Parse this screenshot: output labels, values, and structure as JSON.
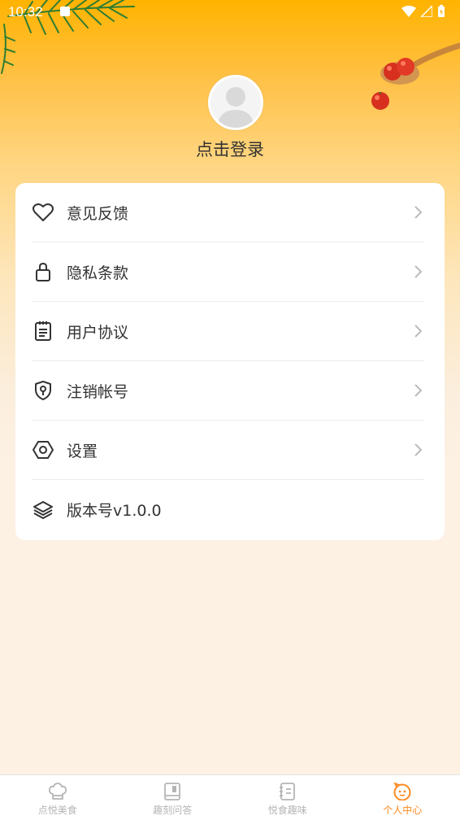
{
  "status_bar": {
    "time": "10:32"
  },
  "profile": {
    "login_text": "点击登录"
  },
  "menu": {
    "items": [
      {
        "label": "意见反馈",
        "icon": "heart-icon"
      },
      {
        "label": "隐私条款",
        "icon": "lock-icon"
      },
      {
        "label": "用户协议",
        "icon": "clipboard-icon"
      },
      {
        "label": "注销帐号",
        "icon": "shield-key-icon"
      },
      {
        "label": "设置",
        "icon": "hexagon-settings-icon"
      },
      {
        "label": "版本号v1.0.0",
        "icon": "layers-icon"
      }
    ]
  },
  "tabbar": {
    "tabs": [
      {
        "label": "点悦美食",
        "icon": "chef-hat-icon"
      },
      {
        "label": "趣刻问答",
        "icon": "book-icon"
      },
      {
        "label": "悦食趣味",
        "icon": "notebook-icon"
      },
      {
        "label": "个人中心",
        "icon": "smiley-icon",
        "active": true
      }
    ]
  },
  "colors": {
    "accent": "#ff8a1f",
    "header_top": "#ffb300",
    "background": "#fdf1e4"
  }
}
